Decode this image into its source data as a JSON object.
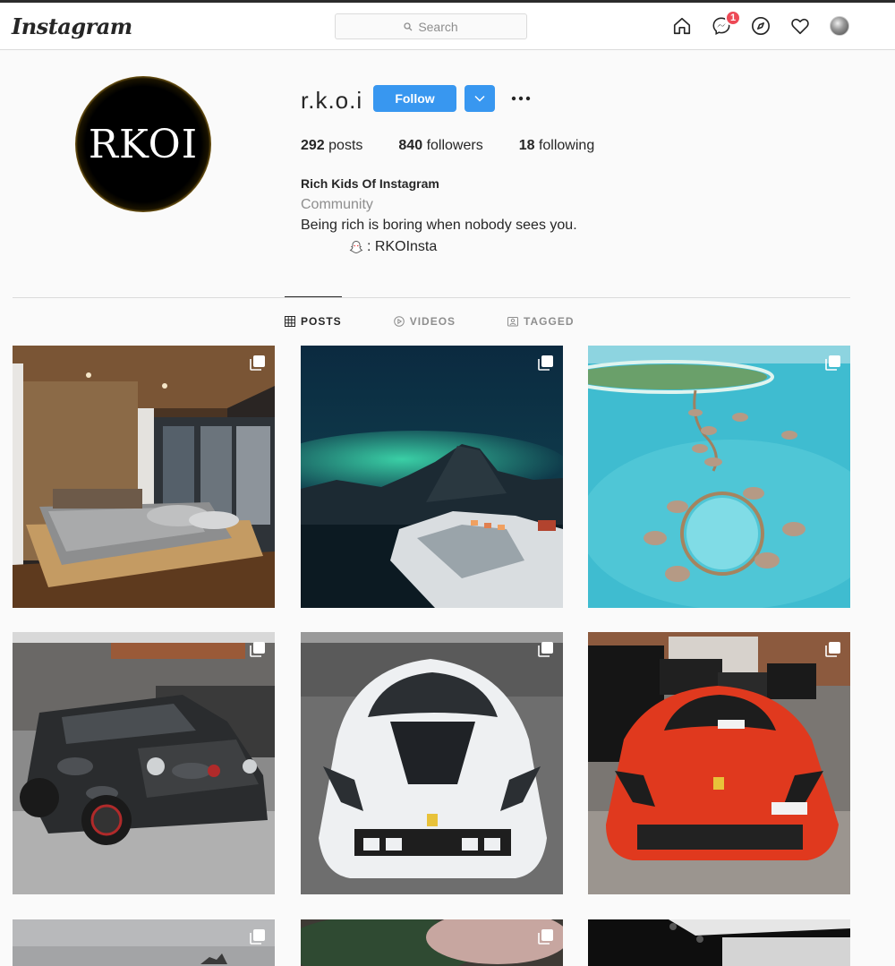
{
  "nav": {
    "logo": "Instagram",
    "search_placeholder": "Search",
    "notification_count": "1",
    "icons": [
      "home-icon",
      "messenger-icon",
      "explore-icon",
      "activity-heart-icon",
      "profile-avatar"
    ]
  },
  "profile": {
    "avatar_text": "RKOI",
    "username": "r.k.o.i",
    "follow_label": "Follow",
    "stats": {
      "posts_count": "292",
      "posts_label": "posts",
      "followers_count": "840",
      "followers_label": "followers",
      "following_count": "18",
      "following_label": "following"
    },
    "bio": {
      "name": "Rich Kids Of Instagram",
      "category": "Community",
      "text": "Being rich is boring when nobody sees you.",
      "snapchat": ": RKOInsta"
    }
  },
  "tabs": [
    {
      "label": "POSTS",
      "active": true
    },
    {
      "label": "VIDEOS",
      "active": false
    },
    {
      "label": "TAGGED",
      "active": false
    }
  ],
  "posts": [
    {
      "subject": "bedroom",
      "multi": true
    },
    {
      "subject": "aurora-mountain",
      "multi": true
    },
    {
      "subject": "maldives-resort",
      "multi": true
    },
    {
      "subject": "camo-g-wagon",
      "multi": true
    },
    {
      "subject": "white-ferrari",
      "multi": true
    },
    {
      "subject": "red-ferrari",
      "multi": true
    },
    {
      "subject": "partial-1",
      "multi": true
    },
    {
      "subject": "partial-2",
      "multi": true
    },
    {
      "subject": "partial-3",
      "multi": false
    }
  ],
  "colors": {
    "accent_blue": "#3897f0",
    "badge_red": "#ed4956",
    "border": "#dbdbdb",
    "muted_text": "#8e8e8e"
  }
}
